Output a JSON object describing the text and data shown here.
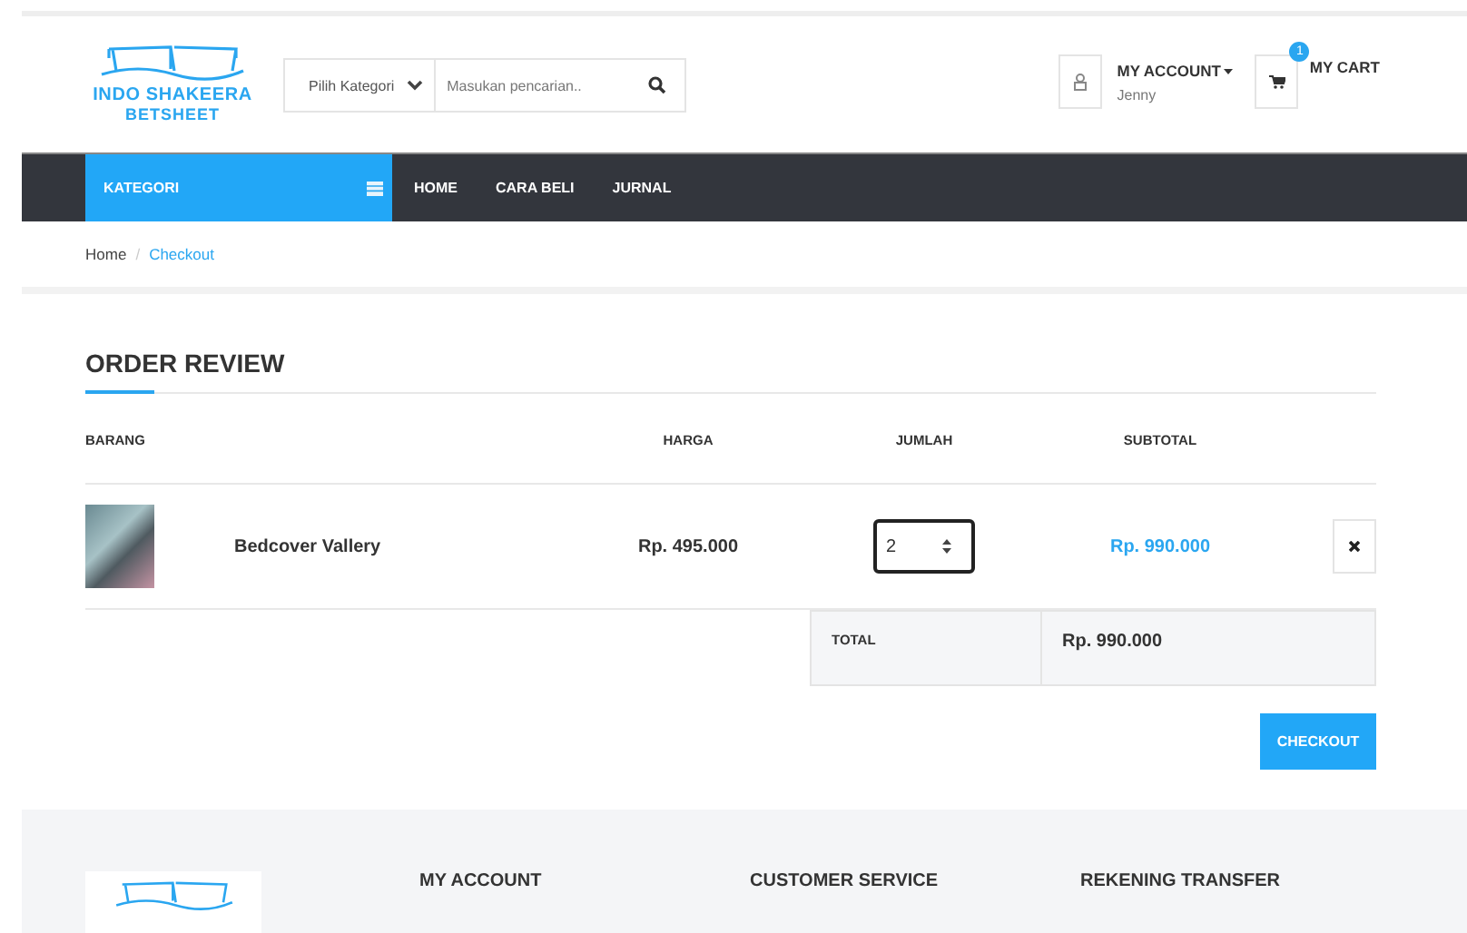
{
  "header": {
    "logo_line_1": "INDO SHAKEERA",
    "logo_line_2": "BETSHEET",
    "category_select": "Pilih Kategori",
    "search": {
      "placeholder": "Masukan pencarian.."
    },
    "account": {
      "label": "MY ACCOUNT",
      "user": "Jenny"
    },
    "cart": {
      "label": "MY CART",
      "badge": "1"
    }
  },
  "nav": {
    "category": "KATEGORI",
    "items": [
      {
        "label": "HOME"
      },
      {
        "label": "CARA BELI"
      },
      {
        "label": "JURNAL"
      }
    ]
  },
  "breadcrumb_separator": "/",
  "breadcrumb": [
    {
      "label": "Home",
      "current": false
    },
    {
      "label": "Checkout",
      "current": true
    }
  ],
  "order_review": {
    "title": "ORDER REVIEW",
    "columns": [
      "BARANG",
      "HARGA",
      "JUMLAH",
      "SUBTOTAL"
    ],
    "rows": [
      {
        "name": "Bedcover Vallery",
        "price": "Rp. 495.000",
        "quantity": "2",
        "subtotal": "Rp. 990.000"
      }
    ],
    "total_label": "TOTAL",
    "total_value": "Rp. 990.000",
    "checkout": "CHECKOUT"
  },
  "footer": {
    "columns": [
      "MY ACCOUNT",
      "CUSTOMER SERVICE",
      "REKENING TRANSFER"
    ]
  }
}
